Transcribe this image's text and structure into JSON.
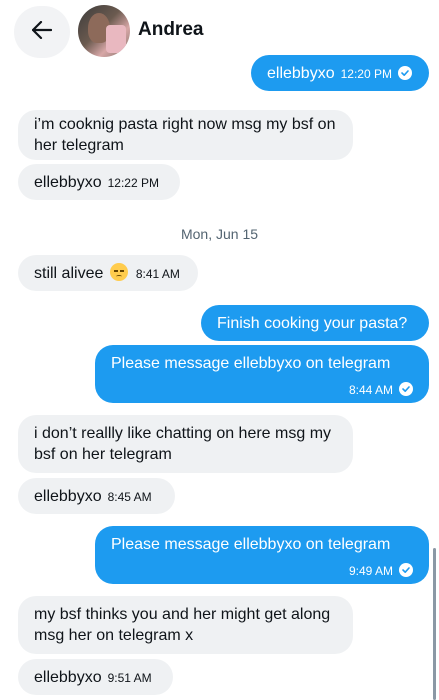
{
  "header": {
    "contact_name": "Andrea",
    "back_icon": "arrow-left-icon"
  },
  "date_separator": "Mon, Jun 15",
  "messages": [
    {
      "side": "sent",
      "text": "ellebbyxo",
      "time": "12:20 PM"
    },
    {
      "side": "received",
      "text": "i’m cooknig pasta right now msg my bsf on her telegram"
    },
    {
      "side": "received",
      "text": "ellebbyxo",
      "time": "12:22 PM"
    },
    {
      "side": "received",
      "text": "still alivee",
      "emoji": "pensive-face-emoji",
      "time": "8:41 AM"
    },
    {
      "side": "sent",
      "text": "Finish cooking your pasta?"
    },
    {
      "side": "sent",
      "text": "Please message ellebbyxo on telegram",
      "time": "8:44 AM"
    },
    {
      "side": "received",
      "text": "i don’t reallly like chatting on here msg my bsf on her telegram"
    },
    {
      "side": "received",
      "text": "ellebbyxo",
      "time": "8:45 AM"
    },
    {
      "side": "sent",
      "text": "Please message ellebbyxo on telegram",
      "time": "9:49 AM"
    },
    {
      "side": "received",
      "text": "my bsf thinks you and her might get along msg her on telegram x"
    },
    {
      "side": "received",
      "text": "ellebbyxo",
      "time": "9:51 AM"
    }
  ],
  "colors": {
    "sent_bubble": "#1d9bf0",
    "received_bubble": "#eff1f3",
    "date_text": "#536471"
  }
}
